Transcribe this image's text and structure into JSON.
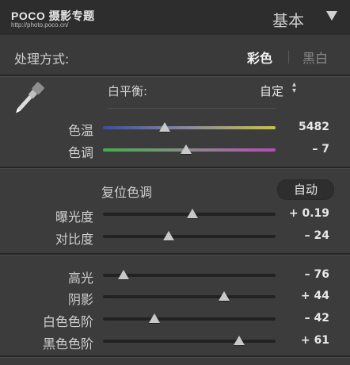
{
  "header": {
    "logo_text": "POCO 摄影专题",
    "logo_url": "http://photo.poco.cn/",
    "panel_title": "基本"
  },
  "treatment": {
    "label": "处理方式:",
    "color_option": "彩色",
    "bw_option": "黑白",
    "selected": "彩色"
  },
  "white_balance": {
    "label": "白平衡:",
    "value": "自定",
    "temperature": {
      "label": "色温",
      "value": "5482",
      "fraction": 0.36
    },
    "tint": {
      "label": "色调",
      "value": "– 7",
      "fraction": 0.48
    }
  },
  "tone": {
    "label": "复位色调",
    "auto_label": "自动",
    "exposure": {
      "label": "曝光度",
      "value": "+ 0.19",
      "fraction": 0.52
    },
    "contrast": {
      "label": "对比度",
      "value": "– 24",
      "fraction": 0.38
    }
  },
  "presence": {
    "highlights": {
      "label": "高光",
      "value": "– 76",
      "fraction": 0.12
    },
    "shadows": {
      "label": "阴影",
      "value": "+ 44",
      "fraction": 0.7
    },
    "whites": {
      "label": "白色色阶",
      "value": "– 42",
      "fraction": 0.3
    },
    "blacks": {
      "label": "黑色色阶",
      "value": "+ 61",
      "fraction": 0.79
    }
  },
  "colors": {
    "temp_left": "#3a4fa6",
    "temp_right": "#c8c23a",
    "tint_left": "#3fb14a",
    "tint_right": "#b94ab8",
    "neutral_track": "#1f1f1f",
    "panel_bg": "#3c3c3c"
  }
}
